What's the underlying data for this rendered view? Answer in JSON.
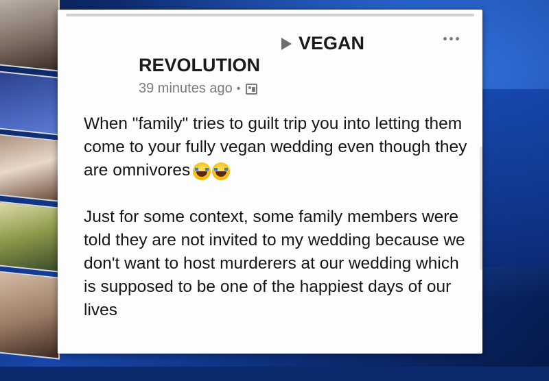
{
  "post": {
    "page_name_line1": "VEGAN",
    "page_name_line2": "REVOLUTION",
    "timestamp": "39 minutes ago",
    "separator": "•",
    "paragraph1": "When \"family\" tries to guilt trip you into letting them come to your fully vegan wedding even though they are omnivores",
    "paragraph2": "Just for some context, some family members were told they are not invited to my wedding because we don't want to host murderers at our wedding which is supposed to be one of the happiest days of our lives",
    "emojis": [
      "laughing-crying-emoji",
      "laughing-crying-emoji"
    ]
  },
  "icons": {
    "play": "play-icon",
    "more": "more-options-icon",
    "audience": "audience-icon"
  },
  "colors": {
    "card_background": "#fdfdfd",
    "text": "#161616",
    "meta_text": "#7c7c7c",
    "background_blue": "#1846a8"
  }
}
